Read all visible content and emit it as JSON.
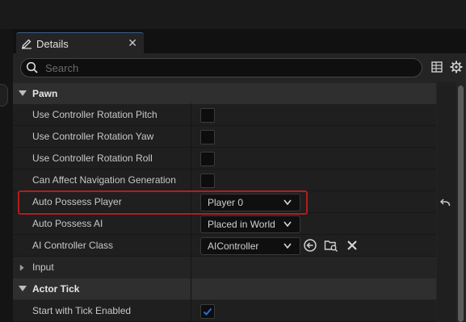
{
  "tab": {
    "title": "Details",
    "close": "✕"
  },
  "search": {
    "placeholder": "Search"
  },
  "sections": {
    "pawn": "Pawn",
    "input": "Input",
    "actor_tick": "Actor Tick"
  },
  "rows": {
    "pitch": "Use Controller Rotation Pitch",
    "yaw": "Use Controller Rotation Yaw",
    "roll": "Use Controller Rotation Roll",
    "nav": "Can Affect Navigation Generation",
    "auto_player": "Auto Possess Player",
    "auto_ai": "Auto Possess AI",
    "ai_class": "AI Controller Class",
    "tick_enabled": "Start with Tick Enabled"
  },
  "values": {
    "auto_player": "Player 0",
    "auto_ai": "Placed in World",
    "ai_class": "AIController",
    "pitch_checked": false,
    "yaw_checked": false,
    "roll_checked": false,
    "nav_checked": false,
    "tick_checked": true
  },
  "colors": {
    "highlight": "#b21d1d",
    "accent": "#2b6fd6",
    "panel": "#242424"
  },
  "icons": [
    "pencil-icon",
    "close-icon",
    "search-icon",
    "grid-icon",
    "gear-icon",
    "chevron-down-icon",
    "chevron-right-icon",
    "reset-arrow-icon",
    "use-selected-icon",
    "browse-icon",
    "clear-icon",
    "checkmark-icon"
  ]
}
